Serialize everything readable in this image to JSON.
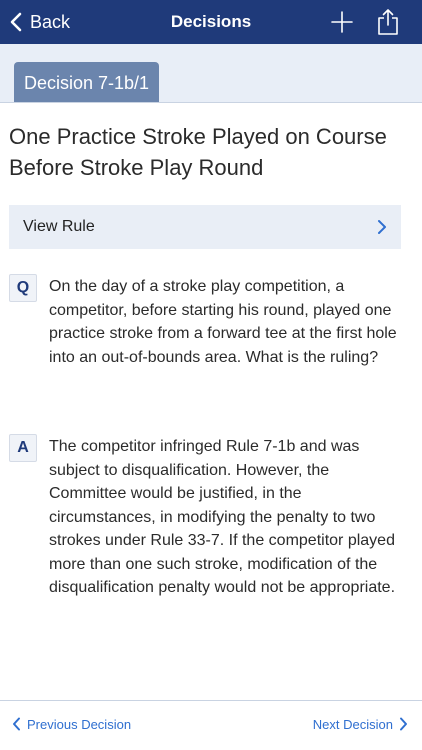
{
  "nav": {
    "back_label": "Back",
    "title": "Decisions",
    "background": "#1f3a7a"
  },
  "decision": {
    "tab_label": "Decision 7-1b/1",
    "title": "One Practice Stroke Played on Course Before Stroke Play Round"
  },
  "view_rule": {
    "label": "View Rule"
  },
  "question": {
    "badge": "Q",
    "text": "On the day of a stroke play competition, a competitor, before starting his round, played one practice stroke from a forward tee at the first hole into an out-of-bounds area. What is the ruling?"
  },
  "answer": {
    "badge": "A",
    "text": "The competitor infringed Rule 7-1b and was subject to disqualification. However, the Committee would be justified, in the circumstances, in modifying the penalty to two strokes under Rule 33-7. If the competitor played more than one such stroke, modification of the disqualification penalty would not be appropriate."
  },
  "footer": {
    "previous_label": "Previous Decision",
    "next_label": "Next Decision",
    "link_color": "#2f6fd0"
  },
  "icons": {
    "back": "chevron-left-icon",
    "add": "plus-icon",
    "share": "share-icon",
    "view_rule": "chevron-right-icon"
  }
}
